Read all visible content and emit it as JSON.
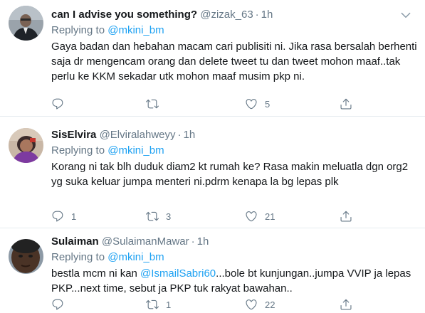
{
  "tweets": [
    {
      "display_name": "can I advise you something?",
      "handle": "@zizak_63",
      "dot": "·",
      "time": "1h",
      "replying_to_label": "Replying to",
      "replying_to_handle": "@mkini_bm",
      "text": "Gaya badan dan hebahan macam cari publisiti ni.  Jika rasa bersalah berhenti saja dr mengencam orang dan delete tweet tu dan tweet mohon maaf..tak perlu ke KKM sekadar utk mohon maaf musim pkp ni.",
      "replies": "",
      "retweets": "",
      "likes": "5"
    },
    {
      "display_name": "SisElvira",
      "handle": "@Elviralahweyy",
      "dot": "·",
      "time": "1h",
      "replying_to_label": "Replying to",
      "replying_to_handle": "@mkini_bm",
      "text": "Korang ni tak blh duduk diam2 kt rumah ke? Rasa makin meluatla dgn org2 yg suka keluar jumpa menteri ni.pdrm kenapa la bg lepas plk",
      "replies": "1",
      "retweets": "3",
      "likes": "21"
    },
    {
      "display_name": "Sulaiman",
      "handle": "@SulaimanMawar",
      "dot": "·",
      "time": "1h",
      "replying_to_label": "Replying to",
      "replying_to_handle": "@mkini_bm",
      "text_prefix": "bestla mcm ni kan ",
      "text_mention": "@IsmailSabri60",
      "text_suffix": "...bole bt kunjungan..jumpa VVIP ja lepas PKP...next time, sebut ja PKP tuk rakyat bawahan..",
      "replies": "",
      "retweets": "1",
      "likes": "22"
    }
  ],
  "icons": {
    "reply": "reply-icon",
    "retweet": "retweet-icon",
    "like": "like-icon",
    "share": "share-icon",
    "more": "chevron-down-icon"
  },
  "colors": {
    "link": "#1da1f2",
    "secondary_text": "#657786",
    "divider": "#e6ecf0"
  }
}
